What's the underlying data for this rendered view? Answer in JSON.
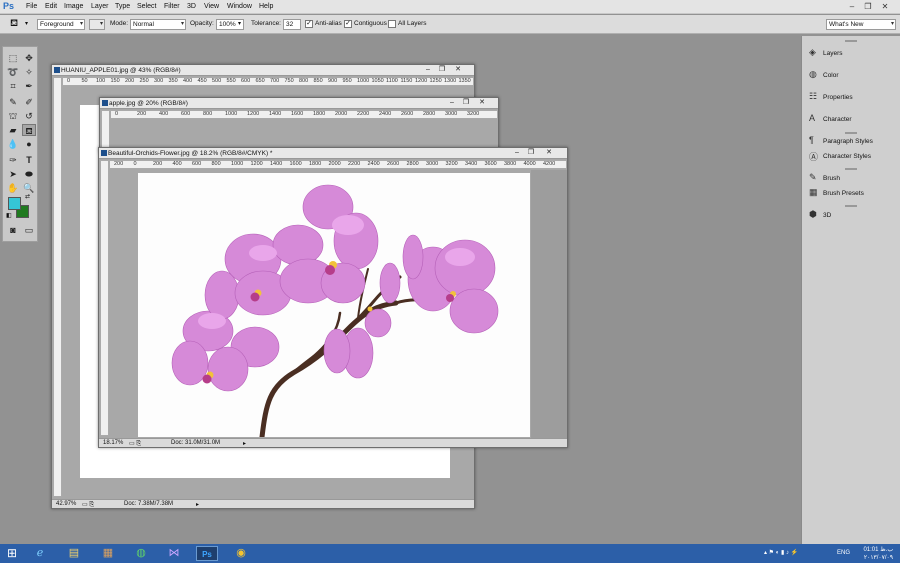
{
  "app": {
    "logo": "Ps"
  },
  "menu": [
    "File",
    "Edit",
    "Image",
    "Layer",
    "Type",
    "Select",
    "Filter",
    "3D",
    "View",
    "Window",
    "Help"
  ],
  "window_controls": [
    "–",
    "❐",
    "✕"
  ],
  "options": {
    "sample": "Foreground",
    "mode_label": "Mode:",
    "mode_value": "Normal",
    "opacity_label": "Opacity:",
    "opacity_value": "100%",
    "tolerance_label": "Tolerance:",
    "tolerance_value": "32",
    "anti_alias": "Anti-alias",
    "contiguous": "Contiguous",
    "all_layers": "All Layers",
    "workspace": "What's New"
  },
  "panels": [
    {
      "label": "Layers",
      "icon": "layers-icon"
    },
    {
      "label": "Color",
      "icon": "color-icon"
    },
    {
      "label": "Properties",
      "icon": "properties-icon"
    },
    {
      "label": "Character",
      "icon": "character-icon"
    },
    {
      "label": "Paragraph Styles",
      "icon": "paragraph-styles-icon"
    },
    {
      "label": "Character Styles",
      "icon": "character-styles-icon"
    },
    {
      "label": "Brush",
      "icon": "brush-icon"
    },
    {
      "label": "Brush Presets",
      "icon": "brush-presets-icon"
    },
    {
      "label": "3D",
      "icon": "3d-icon"
    }
  ],
  "docs": {
    "huaniu": {
      "title": "HUANIU_APPLE01.jpg @ 43% (RGB/8#)",
      "zoom": "42.97%",
      "doc": "Doc: 7.38M/7.38M",
      "ruler": [
        "0",
        "50",
        "100",
        "150",
        "200",
        "250",
        "300",
        "350",
        "400",
        "450",
        "500",
        "550",
        "600",
        "650",
        "700",
        "750",
        "800",
        "850",
        "900",
        "950",
        "1000",
        "1050",
        "1100",
        "1150",
        "1200",
        "1250",
        "1300",
        "1350"
      ]
    },
    "apple": {
      "title": "apple.jpg @ 20% (RGB/8#)",
      "ruler": [
        "0",
        "200",
        "400",
        "600",
        "800",
        "1000",
        "1200",
        "1400",
        "1600",
        "1800",
        "2000",
        "2200",
        "2400",
        "2600",
        "2800",
        "3000",
        "3200"
      ]
    },
    "orchid": {
      "title": "Beautiful-Orchids-Flower.jpg @ 18.2% (RGB/8#/CMYK) *",
      "zoom": "18.17%",
      "doc": "Doc: 31.0M/31.0M",
      "ruler": [
        "200",
        "0",
        "200",
        "400",
        "600",
        "800",
        "1000",
        "1200",
        "1400",
        "1600",
        "1800",
        "2000",
        "2200",
        "2400",
        "2600",
        "2800",
        "3000",
        "3200",
        "3400",
        "3600",
        "3800",
        "4000",
        "4200"
      ]
    }
  },
  "colors": {
    "foreground": "#35c6d6",
    "background": "#1f7a1f",
    "flower": "#d68ad8",
    "stem": "#4a2e22"
  },
  "taskbar": {
    "apps": [
      "start-icon",
      "internet-explorer-icon",
      "file-explorer-icon",
      "archive-icon",
      "globe-icon",
      "visual-studio-icon",
      "photoshop-icon",
      "chrome-icon"
    ],
    "language": "ENG",
    "time": "01:01 ب.ظ",
    "date": "۲۰۱۳/۰۷/۰۹"
  }
}
